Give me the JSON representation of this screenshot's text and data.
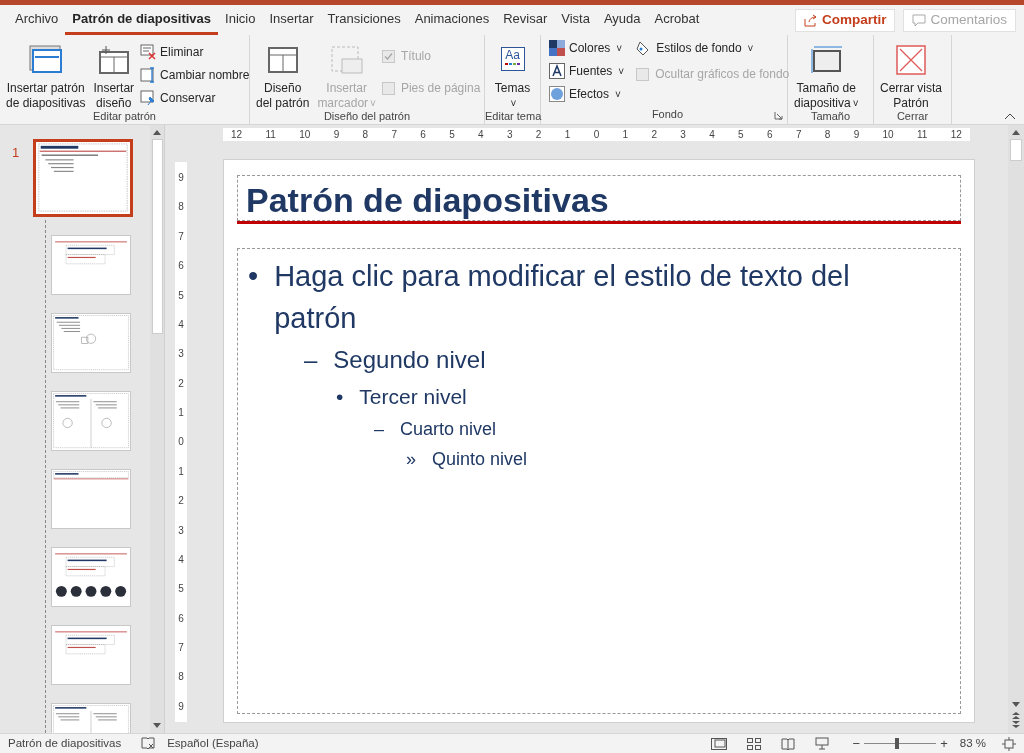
{
  "tabs": [
    {
      "label": "Archivo",
      "selected": false
    },
    {
      "label": "Patrón de diapositivas",
      "selected": true
    },
    {
      "label": "Inicio",
      "selected": false
    },
    {
      "label": "Insertar",
      "selected": false
    },
    {
      "label": "Transiciones",
      "selected": false
    },
    {
      "label": "Animaciones",
      "selected": false
    },
    {
      "label": "Revisar",
      "selected": false
    },
    {
      "label": "Vista",
      "selected": false
    },
    {
      "label": "Ayuda",
      "selected": false
    },
    {
      "label": "Acrobat",
      "selected": false
    }
  ],
  "share_button": "Compartir",
  "comments_button": {
    "label": "Comentarios",
    "disabled": true
  },
  "ribbon": {
    "editar_patron": {
      "label": "Editar patrón",
      "large": [
        {
          "lines": [
            "Insertar patrón",
            "de diapositivas"
          ]
        },
        {
          "lines": [
            "Insertar",
            "diseño"
          ]
        }
      ],
      "small": [
        "Eliminar",
        "Cambiar nombre",
        "Conservar"
      ]
    },
    "diseno_patron": {
      "label": "Diseño del patrón",
      "large": [
        {
          "lines": [
            "Diseño",
            "del patrón"
          ],
          "disabled": false
        },
        {
          "lines": [
            "Insertar",
            "marcador"
          ],
          "disabled": true,
          "caret": "˅"
        }
      ],
      "checks": [
        {
          "label": "Título",
          "checked": true,
          "disabled": true
        },
        {
          "label": "Pies de página",
          "checked": false,
          "disabled": true
        }
      ]
    },
    "editar_tema": {
      "label": "Editar tema",
      "button": "Temas",
      "caret": "˅",
      "icon_text": "Aa"
    },
    "fondo": {
      "label": "Fondo",
      "menus": [
        "Colores",
        "Fuentes",
        "Efectos"
      ],
      "caret": "˅",
      "styles": "Estilos de fondo",
      "hide_graphics": {
        "label": "Ocultar gráficos de fondo",
        "checked": false,
        "disabled": true
      }
    },
    "tamano": {
      "label": "Tamaño",
      "lines": [
        "Tamaño de",
        "diapositiva"
      ],
      "caret": "˅"
    },
    "cerrar": {
      "label": "Cerrar",
      "lines": [
        "Cerrar vista",
        "Patrón"
      ]
    }
  },
  "thumbnails": [
    {
      "number": "1",
      "kind": "master",
      "selected": true
    },
    {
      "kind": "title",
      "selected": false
    },
    {
      "kind": "content",
      "selected": false
    },
    {
      "kind": "two-content",
      "selected": false
    },
    {
      "kind": "title-only",
      "selected": false
    },
    {
      "kind": "pictures",
      "selected": false
    },
    {
      "kind": "title",
      "selected": false
    },
    {
      "kind": "comparison",
      "selected": false
    }
  ],
  "ruler_h": [
    "12",
    "11",
    "10",
    "9",
    "8",
    "7",
    "6",
    "5",
    "4",
    "3",
    "2",
    "1",
    "0",
    "1",
    "2",
    "3",
    "4",
    "5",
    "6",
    "7",
    "8",
    "9",
    "10",
    "11",
    "12"
  ],
  "ruler_v": [
    "9",
    "8",
    "7",
    "6",
    "5",
    "4",
    "3",
    "2",
    "1",
    "0",
    "1",
    "2",
    "3",
    "4",
    "5",
    "6",
    "7",
    "8",
    "9"
  ],
  "slide": {
    "title": "Patrón de diapositivas",
    "bullets": [
      {
        "marker": "•",
        "text": "Haga clic para modificar el estilo de texto del patrón",
        "children": [
          {
            "marker": "–",
            "text": "Segundo nivel",
            "children": [
              {
                "marker": "•",
                "text": "Tercer nivel",
                "children": [
                  {
                    "marker": "–",
                    "text": "Cuarto nivel",
                    "children": [
                      {
                        "marker": "»",
                        "text": "Quinto nivel"
                      }
                    ]
                  }
                ]
              }
            ]
          }
        ]
      }
    ]
  },
  "status_bar": {
    "view": "Patrón de diapositivas",
    "language": "Español (España)",
    "zoom_out": "−",
    "zoom_in": "+",
    "zoom": {
      "level": 0.45
    },
    "zoom_text": "83 %"
  }
}
